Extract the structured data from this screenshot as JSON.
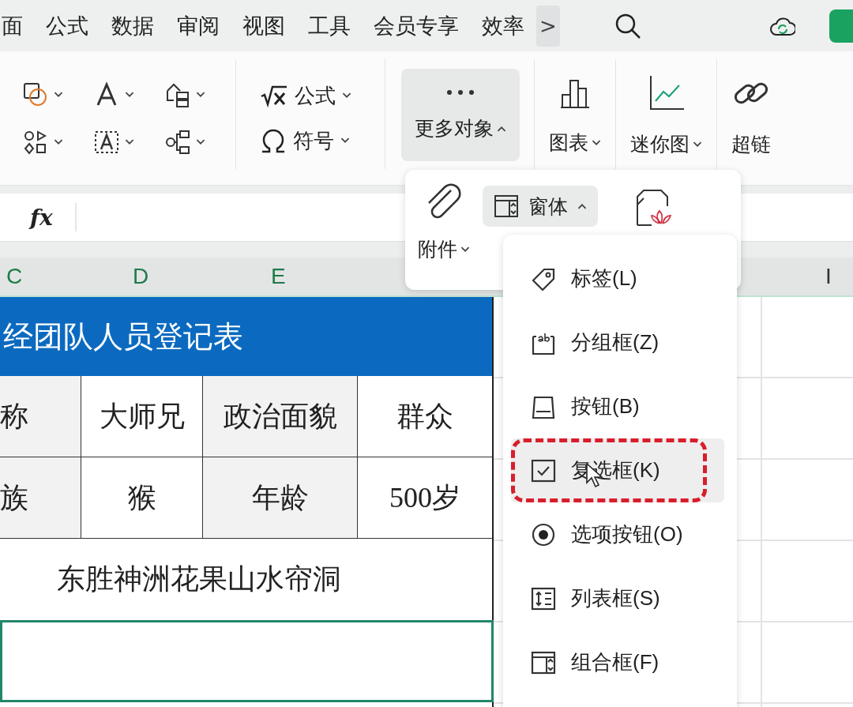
{
  "menu_tabs": [
    "面",
    "公式",
    "数据",
    "审阅",
    "视图",
    "工具",
    "会员专享",
    "效率"
  ],
  "more_tabs_button": ">",
  "ribbon": {
    "formula_tools": [
      {
        "label": "公式",
        "kind": "formula"
      },
      {
        "label": "符号",
        "kind": "symbol"
      }
    ],
    "more_objects": {
      "label": "更多对象",
      "expanded": true
    },
    "insert_tools": [
      {
        "label": "图表",
        "kind": "chart"
      },
      {
        "label": "迷你图",
        "kind": "sparkline"
      },
      {
        "label": "超链",
        "kind": "link"
      }
    ]
  },
  "formula_bar": {
    "function_label": "fx"
  },
  "column_headers": [
    "C",
    "D",
    "E"
  ],
  "far_column_header": "I",
  "sheet": {
    "title": "经团队人员登记表",
    "rows": [
      [
        {
          "text": "称",
          "shaded": true
        },
        {
          "text": "大师兄",
          "shaded": false
        },
        {
          "text": "政治面貌",
          "shaded": true
        },
        {
          "text": "群众",
          "shaded": false
        }
      ],
      [
        {
          "text": "族",
          "shaded": true
        },
        {
          "text": "猴",
          "shaded": false
        },
        {
          "text": "年龄",
          "shaded": true
        },
        {
          "text": "500岁",
          "shaded": false
        }
      ]
    ],
    "address": "东胜神洲花果山水帘洞"
  },
  "objects_popup": {
    "attachment": {
      "label": "附件"
    },
    "form": {
      "label": "窗体",
      "expanded": true
    }
  },
  "form_menu": [
    {
      "label": "标签(L)",
      "kind": "label",
      "selected": false,
      "annotated": false
    },
    {
      "label": "分组框(Z)",
      "kind": "group",
      "selected": false,
      "annotated": false
    },
    {
      "label": "按钮(B)",
      "kind": "button",
      "selected": false,
      "annotated": false
    },
    {
      "label": "复选框(K)",
      "kind": "checkbox",
      "selected": true,
      "annotated": true
    },
    {
      "label": "选项按钮(O)",
      "kind": "radio",
      "selected": false,
      "annotated": false
    },
    {
      "label": "列表框(S)",
      "kind": "list",
      "selected": false,
      "annotated": false
    },
    {
      "label": "组合框(F)",
      "kind": "combo",
      "selected": false,
      "annotated": false
    }
  ]
}
